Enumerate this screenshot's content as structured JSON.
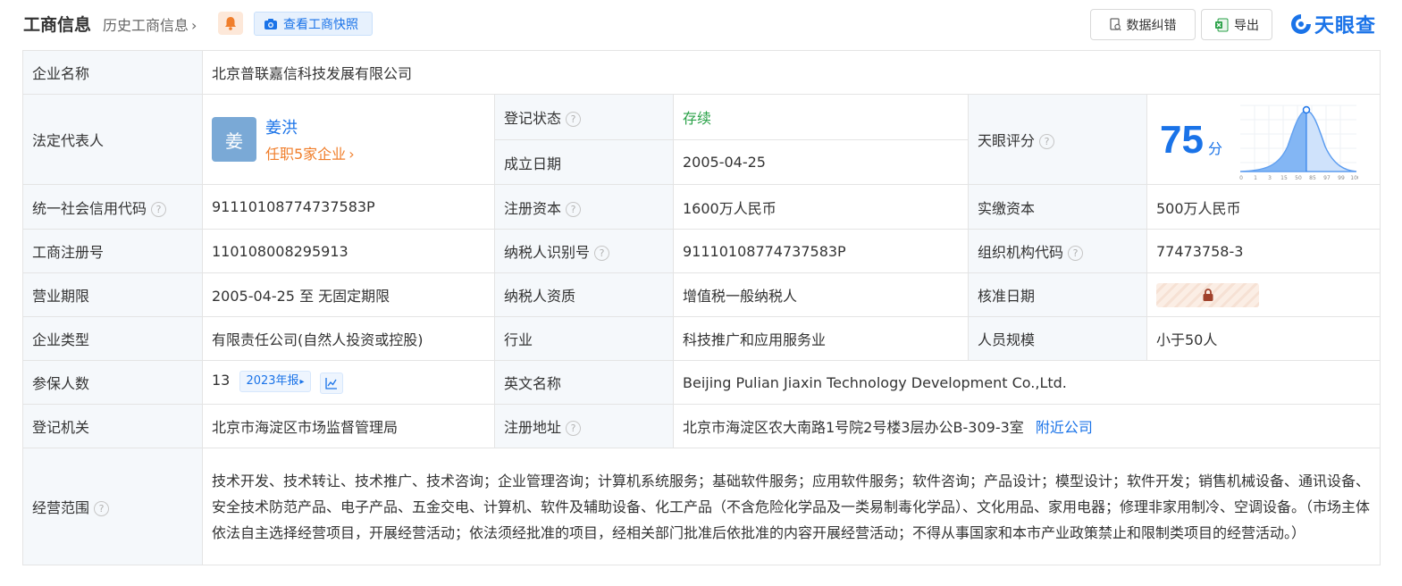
{
  "header": {
    "title": "工商信息",
    "history_link": "历史工商信息",
    "history_chevron": "›",
    "snapshot_label": "查看工商快照",
    "report_label": "数据纠错",
    "export_label": "导出",
    "logo_text": "天眼查",
    "accent_color": "#1a73e8"
  },
  "rows": {
    "company_name": {
      "label": "企业名称",
      "value": "北京普联嘉信科技发展有限公司"
    },
    "legal_rep": {
      "label": "法定代表人",
      "avatar": "姜",
      "name": "姜洪",
      "sub": "任职5家企业",
      "chevron": "›"
    },
    "reg_status": {
      "label": "登记状态",
      "value": "存续"
    },
    "est_date": {
      "label": "成立日期",
      "value": "2005-04-25"
    },
    "tianyan_score": {
      "label": "天眼评分",
      "score": "75",
      "unit": "分",
      "axis_ticks": [
        "0",
        "1",
        "3",
        "15",
        "50",
        "85",
        "97",
        "99",
        "100"
      ]
    },
    "credit_code": {
      "label": "统一社会信用代码",
      "value": "91110108774737583P"
    },
    "reg_capital": {
      "label": "注册资本",
      "value": "1600万人民币"
    },
    "paid_capital": {
      "label": "实缴资本",
      "value": "500万人民币"
    },
    "reg_number": {
      "label": "工商注册号",
      "value": "110108008295913"
    },
    "taxpayer_id": {
      "label": "纳税人识别号",
      "value": "91110108774737583P"
    },
    "org_code": {
      "label": "组织机构代码",
      "value": "77473758-3"
    },
    "business_term": {
      "label": "营业期限",
      "value": "2005-04-25 至 无固定期限"
    },
    "taxpayer_qual": {
      "label": "纳税人资质",
      "value": "增值税一般纳税人"
    },
    "approval_date": {
      "label": "核准日期"
    },
    "company_type": {
      "label": "企业类型",
      "value": "有限责任公司(自然人投资或控股)"
    },
    "industry": {
      "label": "行业",
      "value": "科技推广和应用服务业"
    },
    "staff_size": {
      "label": "人员规模",
      "value": "小于50人"
    },
    "insured": {
      "label": "参保人数",
      "value": "13",
      "report_tag": "2023年报",
      "report_arrow": "▸"
    },
    "english_name": {
      "label": "英文名称",
      "value": "Beijing Pulian Jiaxin Technology Development Co.,Ltd."
    },
    "reg_authority": {
      "label": "登记机关",
      "value": "北京市海淀区市场监督管理局"
    },
    "reg_address": {
      "label": "注册地址",
      "value": "北京市海淀区农大南路1号院2号楼3层办公B-309-3室",
      "nearby": "附近公司"
    },
    "scope": {
      "label": "经营范围",
      "value": "技术开发、技术转让、技术推广、技术咨询；企业管理咨询；计算机系统服务；基础软件服务；应用软件服务；软件咨询；产品设计；模型设计；软件开发；销售机械设备、通讯设备、安全技术防范产品、电子产品、五金交电、计算机、软件及辅助设备、化工产品（不含危险化学品及一类易制毒化学品）、文化用品、家用电器；修理非家用制冷、空调设备。（市场主体依法自主选择经营项目，开展经营活动；依法须经批准的项目，经相关部门批准后依批准的内容开展经营活动；不得从事国家和本市产业政策禁止和限制类项目的经营活动。）"
    }
  },
  "help_glyph": "?"
}
